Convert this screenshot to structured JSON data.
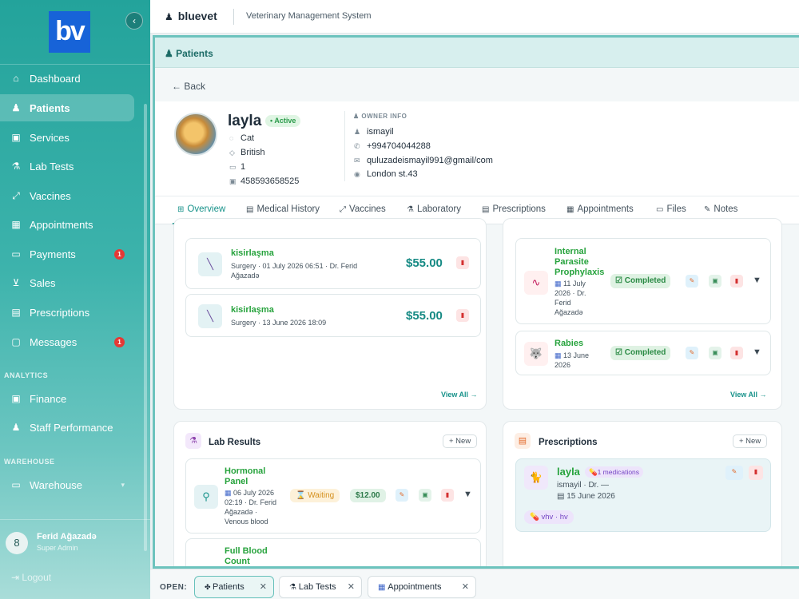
{
  "app": {
    "logo_text": "bv",
    "brand": "bluevet",
    "subtitle": "Veterinary Management System",
    "collapse_glyph": "‹"
  },
  "sidebar": {
    "items": [
      {
        "label": "Dashboard",
        "icon": "home-icon"
      },
      {
        "label": "Patients",
        "icon": "users-icon",
        "active": true
      },
      {
        "label": "Services",
        "icon": "services-icon"
      },
      {
        "label": "Lab Tests",
        "icon": "flask-icon"
      },
      {
        "label": "Vaccines",
        "icon": "syringe-icon"
      },
      {
        "label": "Appointments",
        "icon": "calendar-icon"
      },
      {
        "label": "Payments",
        "icon": "card-icon",
        "badge": "1"
      },
      {
        "label": "Sales",
        "icon": "cart-icon"
      },
      {
        "label": "Prescriptions",
        "icon": "document-icon"
      },
      {
        "label": "Messages",
        "icon": "message-icon",
        "badge": "1"
      }
    ],
    "analytics_label": "ANALYTICS",
    "analytics_items": [
      {
        "label": "Finance",
        "icon": "money-icon"
      },
      {
        "label": "Staff Performance",
        "icon": "team-icon"
      }
    ],
    "warehouse_label": "WAREHOUSE",
    "warehouse_items": [
      {
        "label": "Warehouse",
        "icon": "box-icon"
      }
    ],
    "user": {
      "initial": "8",
      "name": "Ferid Ağazadə",
      "role": "Super Admin"
    },
    "logout": "Logout"
  },
  "page": {
    "title": "Patients",
    "back": "Back"
  },
  "patient": {
    "name": "layla",
    "status": "• Active",
    "species": "Cat",
    "breed": "British",
    "age": "1",
    "chip": "458593658525"
  },
  "owner": {
    "title": "OWNER INFO",
    "name": "ismayil",
    "phone": "+994704044288",
    "email": "quluzadeismayil991@gmail/com",
    "address": "London st.43"
  },
  "tabs": [
    "Overview",
    "Medical History",
    "Vaccines",
    "Laboratory",
    "Prescriptions",
    "Appointments",
    "Files",
    "Notes"
  ],
  "services_card": {
    "items": [
      {
        "name": "kisirlaşma",
        "detail_1": "Surgery · 01 July 2026 06:51 · Dr. Ferid",
        "detail_2": "Ağazadə",
        "price": "$55.00"
      },
      {
        "name": "kisirlaşma",
        "detail_1": "Surgery · 13 June 2026 18:09",
        "detail_2": "",
        "price": "$55.00"
      }
    ],
    "view_all": "View All →"
  },
  "vaccines_card": {
    "items": [
      {
        "name_lines": [
          "Internal",
          "Parasite",
          "Prophylaxis"
        ],
        "date": "11 July",
        "date_2": "2026 · Dr.",
        "date_3": "Ferid",
        "date_4": "Ağazadə",
        "status": "Completed"
      },
      {
        "name_lines": [
          "Rabies"
        ],
        "date": "13 June",
        "date_2": "2026",
        "status": "Completed"
      }
    ],
    "view_all": "View All →"
  },
  "lab_card": {
    "title": "Lab Results",
    "new": "+ New",
    "items": [
      {
        "name_lines": [
          "Hormonal",
          "Panel"
        ],
        "date": "06 July 2026",
        "detail_1": "02:19 · Dr. Ferid",
        "detail_2": "Ağazadə ·",
        "detail_3": "Venous blood",
        "status": "Waiting",
        "price": "$12.00"
      },
      {
        "name_lines": [
          "Full Blood",
          "Count"
        ]
      }
    ]
  },
  "rx_card": {
    "title": "Prescriptions",
    "new": "+ New",
    "item": {
      "pet": "layla",
      "meds": "1 medications",
      "owner": "ismayil · Dr. —",
      "date": "15 June 2026",
      "drug": "vhv · hv"
    }
  },
  "open_tabs": {
    "label": "OPEN:",
    "tabs": [
      "Patients",
      "Lab Tests",
      "Appointments"
    ]
  }
}
